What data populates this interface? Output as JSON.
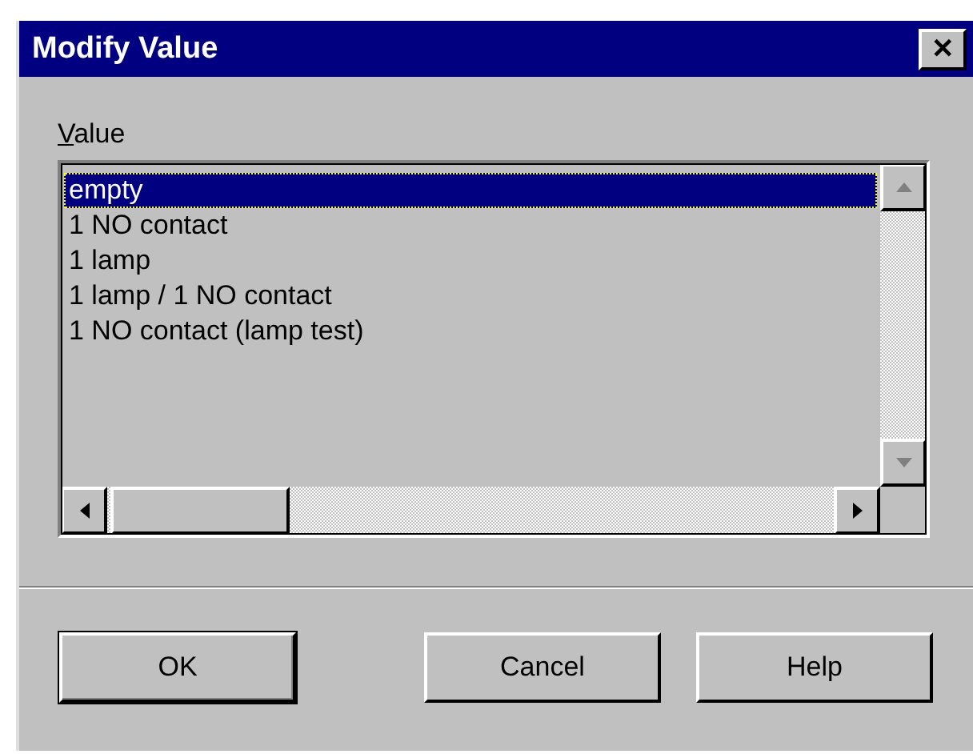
{
  "window": {
    "title": "Modify Value",
    "close_glyph": "✕"
  },
  "value_label": "Value",
  "list": {
    "items": [
      {
        "label": "empty",
        "selected": true
      },
      {
        "label": "1 NO contact",
        "selected": false
      },
      {
        "label": "1 lamp",
        "selected": false
      },
      {
        "label": "1 lamp / 1 NO contact",
        "selected": false
      },
      {
        "label": "1 NO contact (lamp test)",
        "selected": false
      }
    ]
  },
  "buttons": [
    {
      "label": "OK",
      "default": true
    },
    {
      "label": "Cancel",
      "default": false
    },
    {
      "label": "Help",
      "default": false
    }
  ]
}
